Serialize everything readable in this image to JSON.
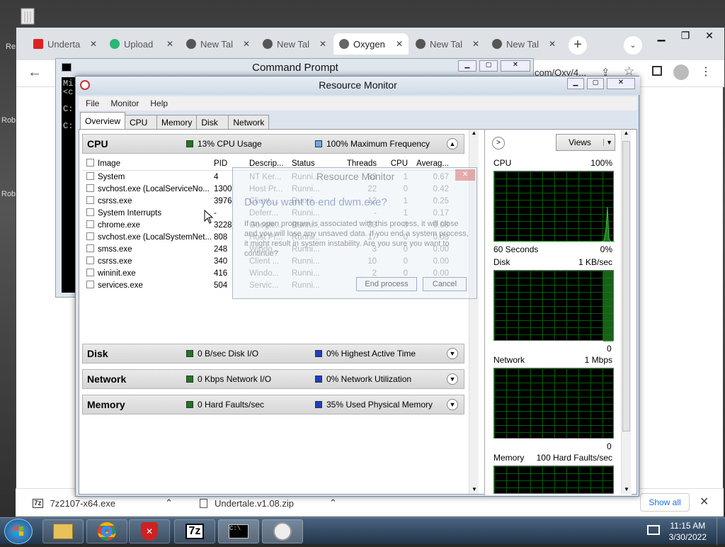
{
  "desktop": {
    "labels": [
      "Re",
      "Rob",
      "Rob"
    ]
  },
  "chrome": {
    "tabs": [
      {
        "title": "Underta",
        "active": false
      },
      {
        "title": "Upload",
        "active": false
      },
      {
        "title": "New Tal",
        "active": false
      },
      {
        "title": "New Tal",
        "active": false
      },
      {
        "title": "Oxygen",
        "active": true
      },
      {
        "title": "New Tal",
        "active": false
      },
      {
        "title": "New Tal",
        "active": false
      }
    ],
    "url_fragment": "com/Oxy/4..."
  },
  "downloads": {
    "items": [
      "7z2107-x64.exe",
      "Undertale.v1.08.zip"
    ],
    "show_all": "Show all"
  },
  "cmd": {
    "title": "Command Prompt",
    "lines": [
      "Mi",
      "<c",
      "",
      "C:",
      "",
      "C:"
    ]
  },
  "resmon": {
    "title": "Resource Monitor",
    "menu": [
      "File",
      "Monitor",
      "Help"
    ],
    "tabs": [
      "Overview",
      "CPU",
      "Memory",
      "Disk",
      "Network"
    ],
    "cpu": {
      "name": "CPU",
      "usage": "13% CPU Usage",
      "freq": "100% Maximum Frequency"
    },
    "columns": [
      "Image",
      "PID",
      "Descrip...",
      "Status",
      "Threads",
      "CPU",
      "Averag..."
    ],
    "processes": [
      {
        "image": "System",
        "pid": "4",
        "desc": "NT Ker...",
        "status": "Runni...",
        "threads": "83",
        "cpu": "1",
        "avg": "0.67"
      },
      {
        "image": "svchost.exe (LocalServiceNo...",
        "pid": "1300",
        "desc": "Host Pr...",
        "status": "Runni...",
        "threads": "22",
        "cpu": "0",
        "avg": "0.42"
      },
      {
        "image": "csrss.exe",
        "pid": "3976",
        "desc": "Client ...",
        "status": "Runni...",
        "threads": "12",
        "cpu": "1",
        "avg": "0.25"
      },
      {
        "image": "System Interrupts",
        "pid": "-",
        "desc": "Deferr...",
        "status": "Runni...",
        "threads": "-",
        "cpu": "1",
        "avg": "0.17"
      },
      {
        "image": "chrome.exe",
        "pid": "3228",
        "desc": "Google...",
        "status": "Runni...",
        "threads": "33",
        "cpu": "0",
        "avg": "0.08"
      },
      {
        "image": "svchost.exe (LocalSystemNet...",
        "pid": "808",
        "desc": "Host Pr...",
        "status": "Runni...",
        "threads": "17",
        "cpu": "0",
        "avg": "0.08"
      },
      {
        "image": "smss.exe",
        "pid": "248",
        "desc": "Windo...",
        "status": "Runni...",
        "threads": "3",
        "cpu": "0",
        "avg": "0.00"
      },
      {
        "image": "csrss.exe",
        "pid": "340",
        "desc": "Client ...",
        "status": "Runni...",
        "threads": "10",
        "cpu": "0",
        "avg": "0.00"
      },
      {
        "image": "wininit.exe",
        "pid": "416",
        "desc": "Windo...",
        "status": "Runni...",
        "threads": "2",
        "cpu": "0",
        "avg": "0.00"
      },
      {
        "image": "services.exe",
        "pid": "504",
        "desc": "Servic...",
        "status": "Runni...",
        "threads": "",
        "cpu": "",
        "avg": ""
      }
    ],
    "disk": {
      "name": "Disk",
      "io": "0 B/sec Disk I/O",
      "active": "0% Highest Active Time"
    },
    "network": {
      "name": "Network",
      "io": "0 Kbps Network I/O",
      "util": "0% Network Utilization"
    },
    "memory": {
      "name": "Memory",
      "faults": "0 Hard Faults/sec",
      "used": "35% Used Physical Memory"
    },
    "graphs": {
      "views": "Views",
      "cpu": {
        "label": "CPU",
        "max": "100%",
        "foot_left": "60 Seconds",
        "foot_right": "0%"
      },
      "disk": {
        "label": "Disk",
        "max": "1 KB/sec",
        "foot_right": "0"
      },
      "network": {
        "label": "Network",
        "max": "1 Mbps",
        "foot_right": "0"
      },
      "memory": {
        "label": "Memory",
        "max": "100 Hard Faults/sec"
      }
    },
    "colors": {
      "green": "#1d7a1d",
      "blue": "#1f3fbf",
      "lightblue": "#6fa5e8"
    }
  },
  "dialog": {
    "title": "Resource Monitor",
    "heading": "Do you want to end dwm.exe?",
    "text": "If an open program is associated with this process, it will close and you will lose any unsaved data. If you end a system process, it might result in system instability. Are you sure you want to continue?",
    "end_button": "End process",
    "cancel_button": "Cancel"
  },
  "taskbar": {
    "time": "11:15 AM",
    "date": "3/30/2022",
    "apps": [
      "explorer-icon",
      "chrome-icon",
      "shield-icon",
      "7zip-icon",
      "cmd-icon",
      "resmon-icon"
    ]
  }
}
